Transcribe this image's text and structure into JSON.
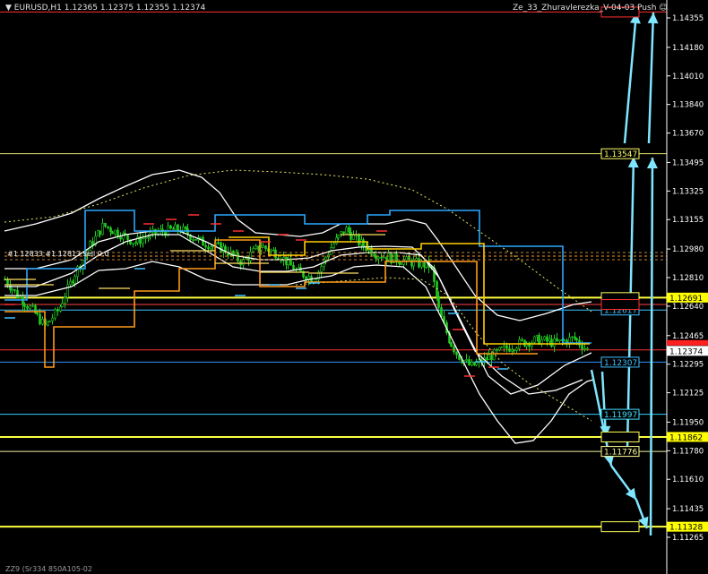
{
  "header": {
    "symbol_line": "EURUSD,H1  1.12365 1.12375 1.12355 1.12374",
    "indicator_name": "Ze_33_Zhuravlerezka_V-04-03  Push",
    "footer_text": "ZZ9 (Sr334 850A105-02",
    "level_labels_left": "#1.12833  #1.12813  sell 0.0",
    "smiley_icon": "smiley-icon"
  },
  "chart_data": {
    "type": "line",
    "title": "",
    "ylim": [
      1.1125,
      1.1445
    ],
    "grid": false,
    "y_ticks": [
      1.14355,
      1.1418,
      1.1401,
      1.1384,
      1.1367,
      1.13495,
      1.13325,
      1.13155,
      1.1298,
      1.1281,
      1.1264,
      1.12465,
      1.12295,
      1.12125,
      1.1195,
      1.1178,
      1.1161,
      1.11435,
      1.11265
    ],
    "current_price": 1.12374,
    "price_tags": [
      {
        "value": 1.13547,
        "text": "1.13547",
        "color": "#ffff66",
        "side": "axis-left"
      },
      {
        "value": 1.12691,
        "text": "1.12691",
        "color": "#ffff00",
        "side": "axis-fill"
      },
      {
        "value": 1.12617,
        "text": "1.12617",
        "color": "#40c0ff",
        "side": "axis-left"
      },
      {
        "value": 1.12307,
        "text": "1.12307",
        "color": "#40c0ff",
        "side": "axis-left"
      },
      {
        "value": 1.11997,
        "text": "1.11997",
        "color": "#40e0ff",
        "side": "axis-left"
      },
      {
        "value": 1.11862,
        "text": "1.11862",
        "color": "#ffff00",
        "side": "axis-fill"
      },
      {
        "value": 1.11776,
        "text": "1.11776",
        "color": "#ffff99",
        "side": "axis-left"
      },
      {
        "value": 1.11328,
        "text": "1.11328",
        "color": "#ffff00",
        "side": "axis-fill"
      },
      {
        "value": 1.12374,
        "text": "1.12374",
        "color": "#ffffff",
        "side": "axis-current"
      }
    ],
    "hlines": [
      {
        "value": 1.1439,
        "color": "#ff3030",
        "width": 1
      },
      {
        "value": 1.13547,
        "color": "#e8e870",
        "width": 1
      },
      {
        "value": 1.12691,
        "color": "#ffff40",
        "width": 2
      },
      {
        "value": 1.1265,
        "color": "#ff4040",
        "width": 1
      },
      {
        "value": 1.12617,
        "color": "#40c0ff",
        "width": 1
      },
      {
        "value": 1.1238,
        "color": "#ff3030",
        "width": 1
      },
      {
        "value": 1.12307,
        "color": "#3090ff",
        "width": 1
      },
      {
        "value": 1.11997,
        "color": "#30d0ff",
        "width": 1
      },
      {
        "value": 1.11862,
        "color": "#ffff40",
        "width": 2
      },
      {
        "value": 1.11776,
        "color": "#f0f0a0",
        "width": 1
      },
      {
        "value": 1.11328,
        "color": "#ffff40",
        "width": 2
      }
    ],
    "colors": {
      "candles": "#22cc22",
      "bands": "#ffffff",
      "channel_blue": "#2aa8ff",
      "channel_orange": "#ff9a1a",
      "channel_yellow": "#ffd000",
      "arrows": "#7fe6ff",
      "axis_text": "#ffffff"
    }
  }
}
